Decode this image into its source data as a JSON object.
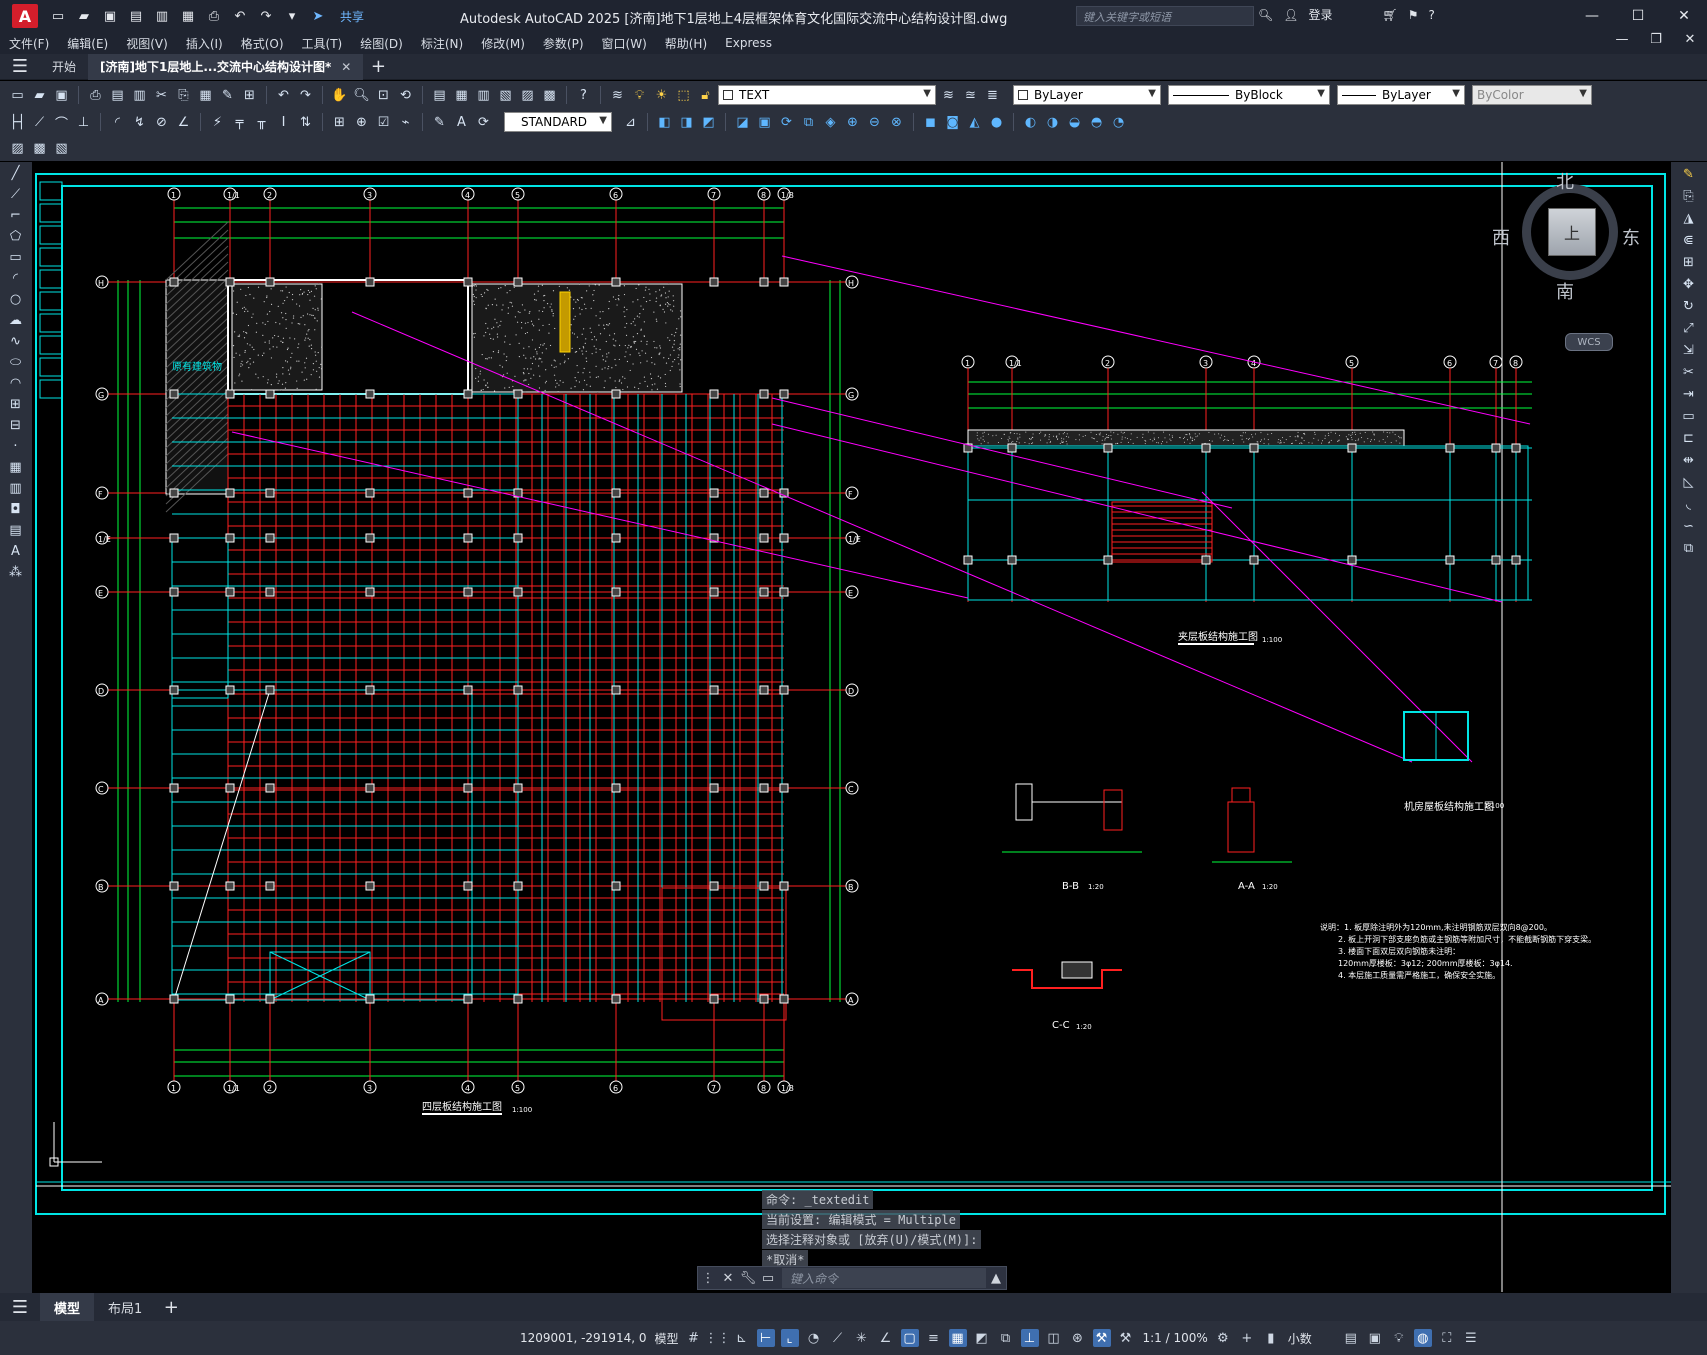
{
  "titlebar": {
    "logo_letter": "A",
    "share_label": "共享",
    "title": "Autodesk AutoCAD 2025    [济南]地下1层地上4层框架体育文化国际交流中心结构设计图.dwg",
    "search_placeholder": "键入关键字或短语",
    "login_label": "登录"
  },
  "menu": [
    "文件(F)",
    "编辑(E)",
    "视图(V)",
    "插入(I)",
    "格式(O)",
    "工具(T)",
    "绘图(D)",
    "标注(N)",
    "修改(M)",
    "参数(P)",
    "窗口(W)",
    "帮助(H)",
    "Express"
  ],
  "tabs": {
    "start": "开始",
    "drawing": "[济南]地下1层地上...交流中心结构设计图*"
  },
  "toolbar": {
    "text_style": "TEXT",
    "dim_style": "STANDARD",
    "layer": "ByLayer",
    "linetype": "ByBlock",
    "lineweight": "ByLayer",
    "color": "ByColor"
  },
  "drawing": {
    "axis_top": [
      "1",
      "1/1",
      "2",
      "3",
      "4",
      "5",
      "6",
      "7",
      "8",
      "1/8"
    ],
    "axis_side": [
      "H",
      "G",
      "F",
      "1/E",
      "E",
      "D",
      "C",
      "B",
      "A"
    ],
    "plan_title": "四层板结构施工图",
    "plan_scale": "1:100",
    "existing_label": "原有建筑物",
    "roof_title": "夹层板结构施工图",
    "roof_scale": "1:100",
    "machine_title": "机房屋板结构施工图",
    "machine_scale": "1:100",
    "section_bb": "B-B",
    "section_aa": "A-A",
    "section_cc": "C-C",
    "section_scale": "1:20",
    "notes": [
      "说明：1. 板厚除注明外为120mm,未注明钢筋双层双向8@200。",
      "2. 板上开洞下部支座负筋或主钢筋等附加尺寸，不能截断钢筋下穿支梁。",
      "3. 楼面下面双层双向钢筋未注明：",
      "120mm厚楼板：3φ12;      200mm厚楼板：3φ14.",
      "4. 本层施工质量需严格施工，确保安全实施。"
    ]
  },
  "viewcube": {
    "north": "北",
    "south": "南",
    "east": "东",
    "west": "西",
    "top": "上",
    "wcs": "WCS"
  },
  "command": {
    "history": [
      "命令: _textedit",
      "当前设置: 编辑模式 = Multiple",
      "选择注释对象或 [放弃(U)/模式(M)]:",
      "*取消*"
    ],
    "placeholder": "键入命令"
  },
  "layout_tabs": [
    "模型",
    "布局1"
  ],
  "status": {
    "coords": "1209001, -291914, 0",
    "model": "模型",
    "scale": "1:1 / 100%",
    "units": "小数"
  },
  "colors": {
    "cyan": "#00e5e5",
    "red": "#ff2020",
    "green": "#00ff3c",
    "magenta": "#ff00ff",
    "white": "#ffffff",
    "yellow": "#ffd400"
  }
}
